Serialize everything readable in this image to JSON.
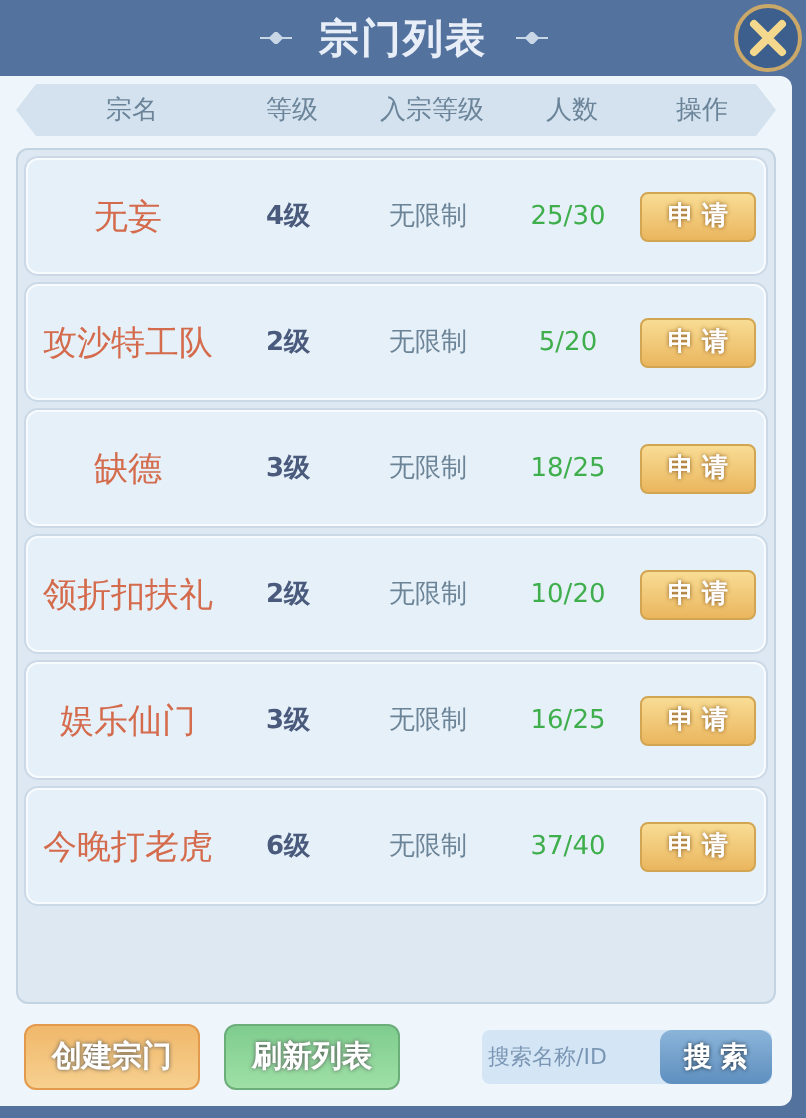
{
  "window": {
    "title": "宗门列表"
  },
  "table": {
    "columns": [
      "宗名",
      "等级",
      "入宗等级",
      "人数",
      "操作"
    ],
    "rows": [
      {
        "name": "无妄",
        "level": "4级",
        "requirement": "无限制",
        "members": "25/30",
        "action": "申 请"
      },
      {
        "name": "攻沙特工队",
        "level": "2级",
        "requirement": "无限制",
        "members": "5/20",
        "action": "申 请"
      },
      {
        "name": "缺德",
        "level": "3级",
        "requirement": "无限制",
        "members": "18/25",
        "action": "申 请"
      },
      {
        "name": "领折扣扶礼",
        "level": "2级",
        "requirement": "无限制",
        "members": "10/20",
        "action": "申 请"
      },
      {
        "name": "娱乐仙门",
        "level": "3级",
        "requirement": "无限制",
        "members": "16/25",
        "action": "申 请"
      },
      {
        "name": "今晚打老虎",
        "level": "6级",
        "requirement": "无限制",
        "members": "37/40",
        "action": "申 请"
      }
    ]
  },
  "footer": {
    "buttons": [
      {
        "label": "创建宗门",
        "kind": "orange"
      },
      {
        "label": "刷新列表",
        "kind": "green"
      }
    ],
    "search": {
      "placeholder": "搜索名称/ID",
      "button": "搜 索"
    }
  }
}
